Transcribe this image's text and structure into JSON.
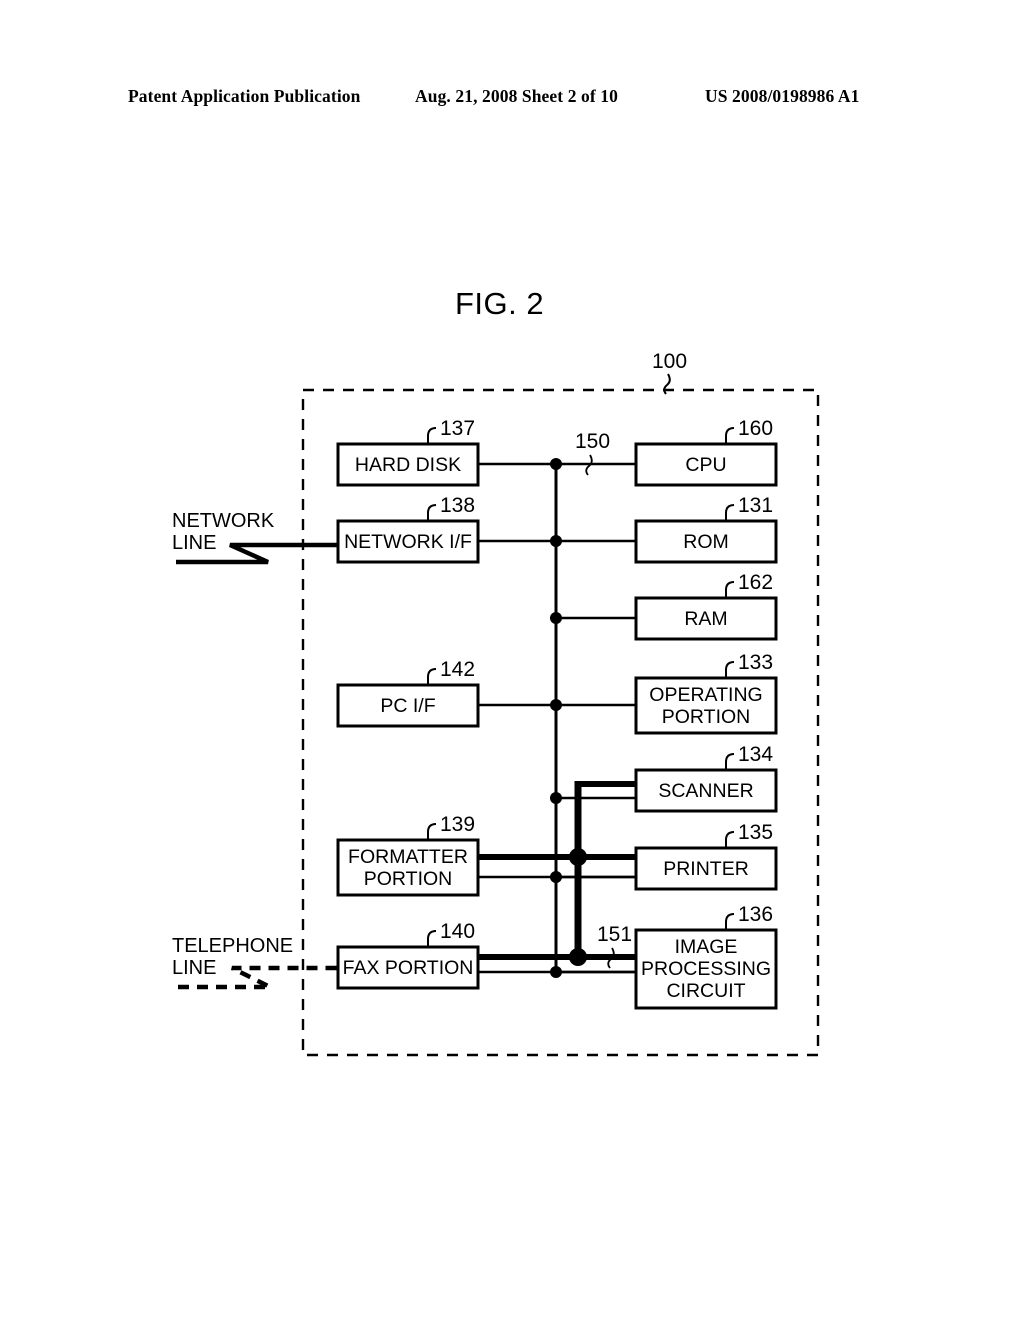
{
  "header": {
    "left": "Patent Application Publication",
    "middle": "Aug. 21, 2008  Sheet 2 of 10",
    "right": "US 2008/0198986 A1"
  },
  "figure": {
    "title": "FIG. 2",
    "enclosure_ref": "100"
  },
  "external_lines": [
    {
      "id": "network-line",
      "label_line1": "NETWORK",
      "label_line2": "LINE",
      "style": "solid"
    },
    {
      "id": "telephone-line",
      "label_line1": "TELEPHONE",
      "label_line2": "LINE",
      "style": "dashed"
    }
  ],
  "buses": [
    {
      "id": "bus-150",
      "ref": "150",
      "weight": "thin"
    },
    {
      "id": "bus-151",
      "ref": "151",
      "weight": "thick"
    }
  ],
  "blocks": [
    {
      "id": "hard-disk",
      "ref": "137",
      "lines": [
        "HARD DISK"
      ]
    },
    {
      "id": "network-if",
      "ref": "138",
      "lines": [
        "NETWORK I/F"
      ]
    },
    {
      "id": "pc-if",
      "ref": "142",
      "lines": [
        "PC I/F"
      ]
    },
    {
      "id": "formatter-portion",
      "ref": "139",
      "lines": [
        "FORMATTER",
        "PORTION"
      ]
    },
    {
      "id": "fax-portion",
      "ref": "140",
      "lines": [
        "FAX PORTION"
      ]
    },
    {
      "id": "cpu",
      "ref": "160",
      "lines": [
        "CPU"
      ]
    },
    {
      "id": "rom",
      "ref": "131",
      "lines": [
        "ROM"
      ]
    },
    {
      "id": "ram",
      "ref": "162",
      "lines": [
        "RAM"
      ]
    },
    {
      "id": "operating-portion",
      "ref": "133",
      "lines": [
        "OPERATING",
        "PORTION"
      ]
    },
    {
      "id": "scanner",
      "ref": "134",
      "lines": [
        "SCANNER"
      ]
    },
    {
      "id": "printer",
      "ref": "135",
      "lines": [
        "PRINTER"
      ]
    },
    {
      "id": "image-processing-circuit",
      "ref": "136",
      "lines": [
        "IMAGE",
        "PROCESSING",
        "CIRCUIT"
      ]
    }
  ],
  "colors": {
    "ink": "#000000",
    "paper": "#ffffff"
  }
}
